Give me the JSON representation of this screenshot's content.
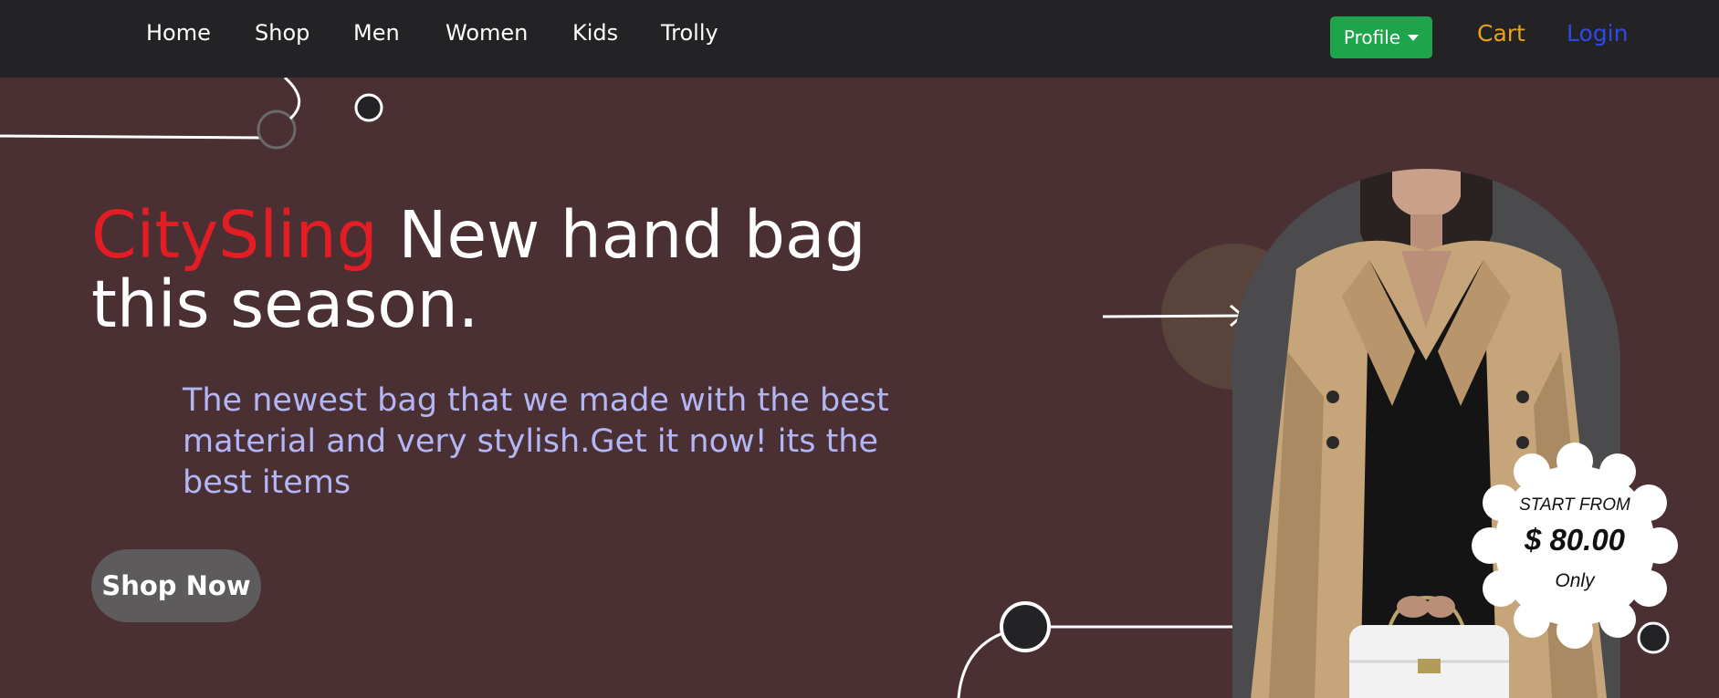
{
  "nav": {
    "links": [
      "Home",
      "Shop",
      "Men",
      "Women",
      "Kids",
      "Trolly"
    ],
    "profile_label": "Profile",
    "cart_label": "Cart",
    "login_label": "Login"
  },
  "hero": {
    "brand": "CitySling",
    "headline_rest": "New hand bag this season.",
    "subtext": "The newest bag that we made with the best material and very stylish.Get it now! its the best items",
    "cta_label": "Shop Now",
    "price_badge": {
      "line1": "START FROM",
      "price": "$ 80.00",
      "line3": "Only"
    }
  },
  "colors": {
    "background": "#4a2f33",
    "navbar": "#232326",
    "brand_red": "#e21d23",
    "subtext": "#b3b6f5",
    "profile_green": "#1ea44a",
    "cart": "#eaa21b",
    "login": "#2f49e8"
  }
}
